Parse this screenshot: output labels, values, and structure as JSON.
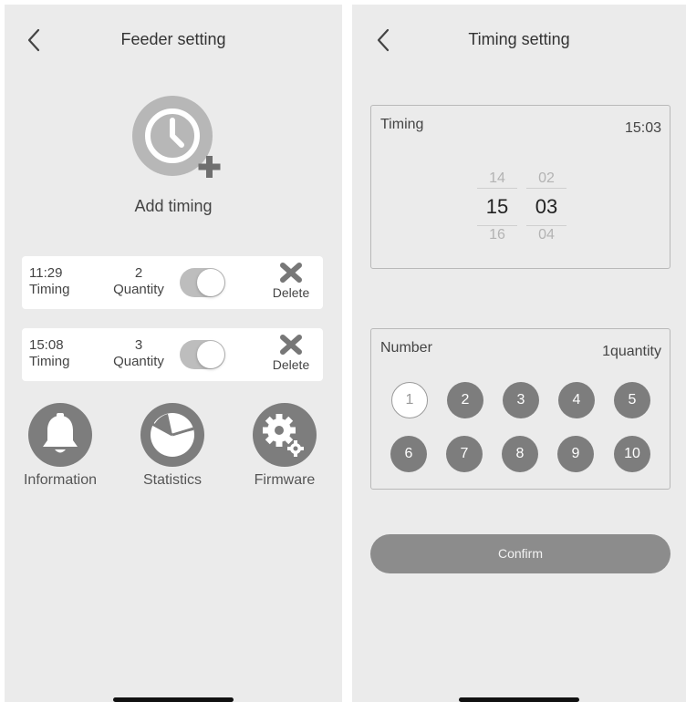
{
  "feeder_screen": {
    "title": "Feeder setting",
    "add_timing_label": "Add timing",
    "timers": [
      {
        "time": "11:29",
        "time_label": "Timing",
        "quantity": "2",
        "quantity_label": "Quantity",
        "enabled": true,
        "delete_label": "Delete"
      },
      {
        "time": "15:08",
        "time_label": "Timing",
        "quantity": "3",
        "quantity_label": "Quantity",
        "enabled": true,
        "delete_label": "Delete"
      }
    ],
    "nav": [
      {
        "label": "Information",
        "icon": "bell-icon"
      },
      {
        "label": "Statistics",
        "icon": "pie-chart-icon"
      },
      {
        "label": "Firmware",
        "icon": "gears-icon"
      }
    ]
  },
  "timing_screen": {
    "title": "Timing setting",
    "timing_panel": {
      "label": "Timing",
      "value": "15:03",
      "hours": {
        "prev": "14",
        "selected": "15",
        "next": "16"
      },
      "minutes": {
        "prev": "02",
        "selected": "03",
        "next": "04"
      }
    },
    "number_panel": {
      "label": "Number",
      "value": "1quantity",
      "numbers": [
        "1",
        "2",
        "3",
        "4",
        "5",
        "6",
        "7",
        "8",
        "9",
        "10"
      ],
      "selected": "1"
    },
    "confirm_label": "Confirm"
  },
  "colors": {
    "background": "#ebebeb",
    "icon_gray": "#7d7d7d",
    "card": "#ffffff",
    "toggle_track": "#bdbdbd",
    "confirm_button": "#8c8c8c"
  }
}
